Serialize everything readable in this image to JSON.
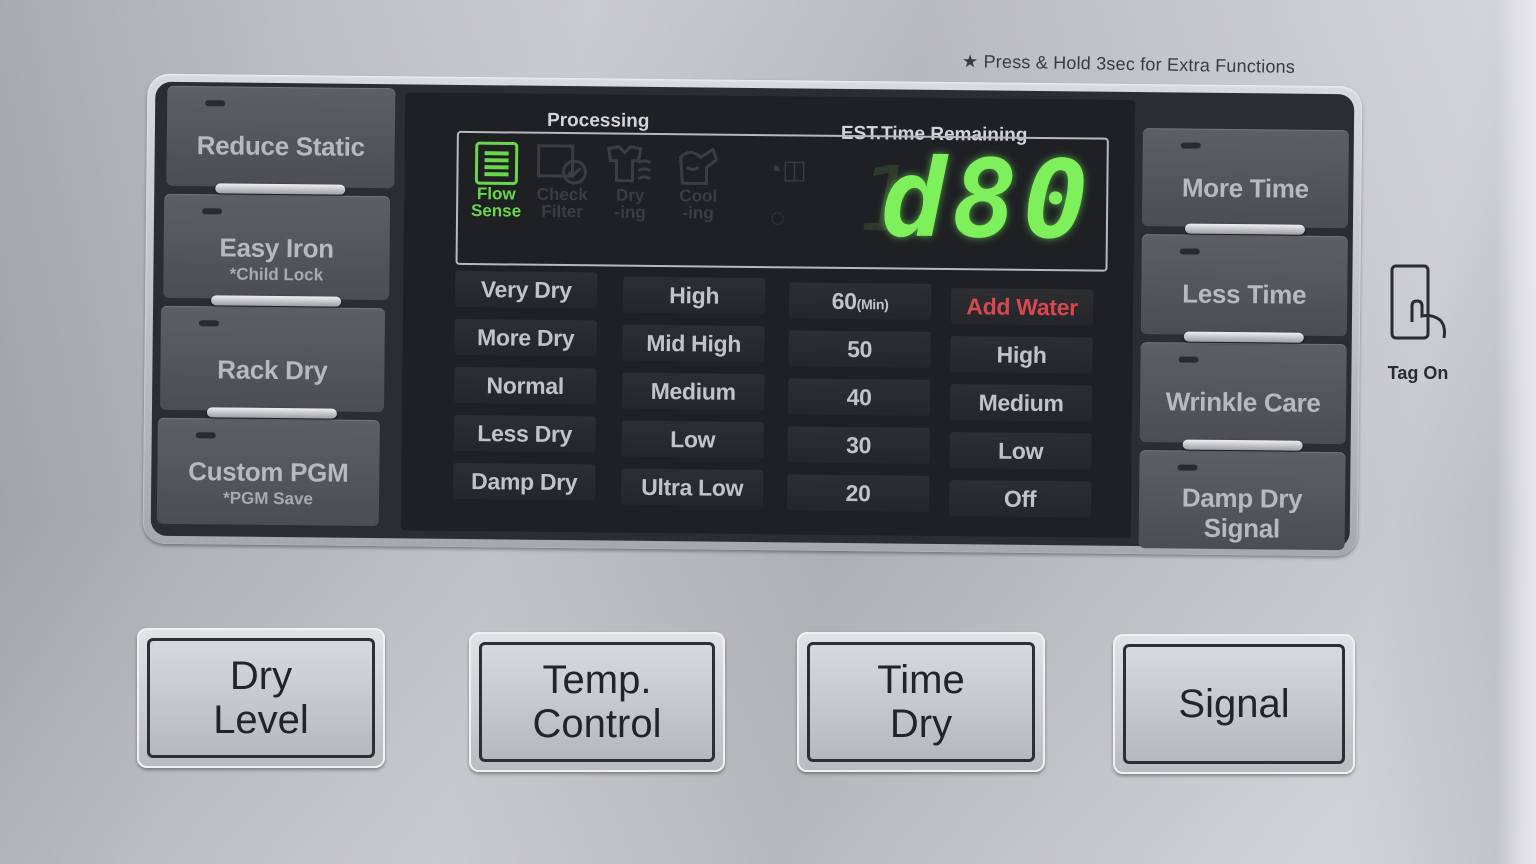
{
  "note": "★ Press & Hold 3sec  for Extra Functions",
  "left_buttons": [
    {
      "label": "Reduce Static",
      "sub": ""
    },
    {
      "label": "Easy Iron",
      "sub": "*Child Lock"
    },
    {
      "label": "Rack Dry",
      "sub": ""
    },
    {
      "label": "Custom PGM",
      "sub": "*PGM Save"
    }
  ],
  "right_buttons": [
    {
      "label": "More Time",
      "line2": ""
    },
    {
      "label": "Less Time",
      "line2": ""
    },
    {
      "label": "Wrinkle Care",
      "line2": ""
    },
    {
      "label": "Damp Dry",
      "line2": "Signal"
    }
  ],
  "display": {
    "processing_label": "Processing",
    "time_label": "EST.Time Remaining",
    "time_value": "d80",
    "stages": [
      {
        "icon": "flow-sense-icon",
        "line1": "Flow",
        "line2": "Sense",
        "active": true
      },
      {
        "icon": "check-filter-icon",
        "line1": "Check",
        "line2": "Filter",
        "active": false
      },
      {
        "icon": "drying-icon",
        "line1": "Dry",
        "line2": "-ing",
        "active": false
      },
      {
        "icon": "cooling-icon",
        "line1": "Cool",
        "line2": "-ing",
        "active": false
      }
    ],
    "columns": [
      {
        "name": "dry-level",
        "items": [
          "Very Dry",
          "More Dry",
          "Normal",
          "Less Dry",
          "Damp Dry"
        ]
      },
      {
        "name": "temp",
        "items": [
          "High",
          "Mid High",
          "Medium",
          "Low",
          "Ultra Low"
        ]
      },
      {
        "name": "time",
        "items": [
          "60",
          "50",
          "40",
          "30",
          "20"
        ],
        "unit": "(Min)"
      },
      {
        "name": "water",
        "items": [
          "Add Water",
          "High",
          "Medium",
          "Low",
          "Off"
        ]
      }
    ],
    "alert_color": "#d8484e",
    "lcd_color": "#7df05c"
  },
  "bottom_buttons": [
    {
      "line1": "Dry",
      "line2": "Level"
    },
    {
      "line1": "Temp.",
      "line2": "Control"
    },
    {
      "line1": "Time",
      "line2": "Dry"
    },
    {
      "line1": "Signal",
      "line2": ""
    }
  ],
  "tag_on": {
    "label": "Tag On",
    "icon": "tag-on-phone-icon"
  }
}
